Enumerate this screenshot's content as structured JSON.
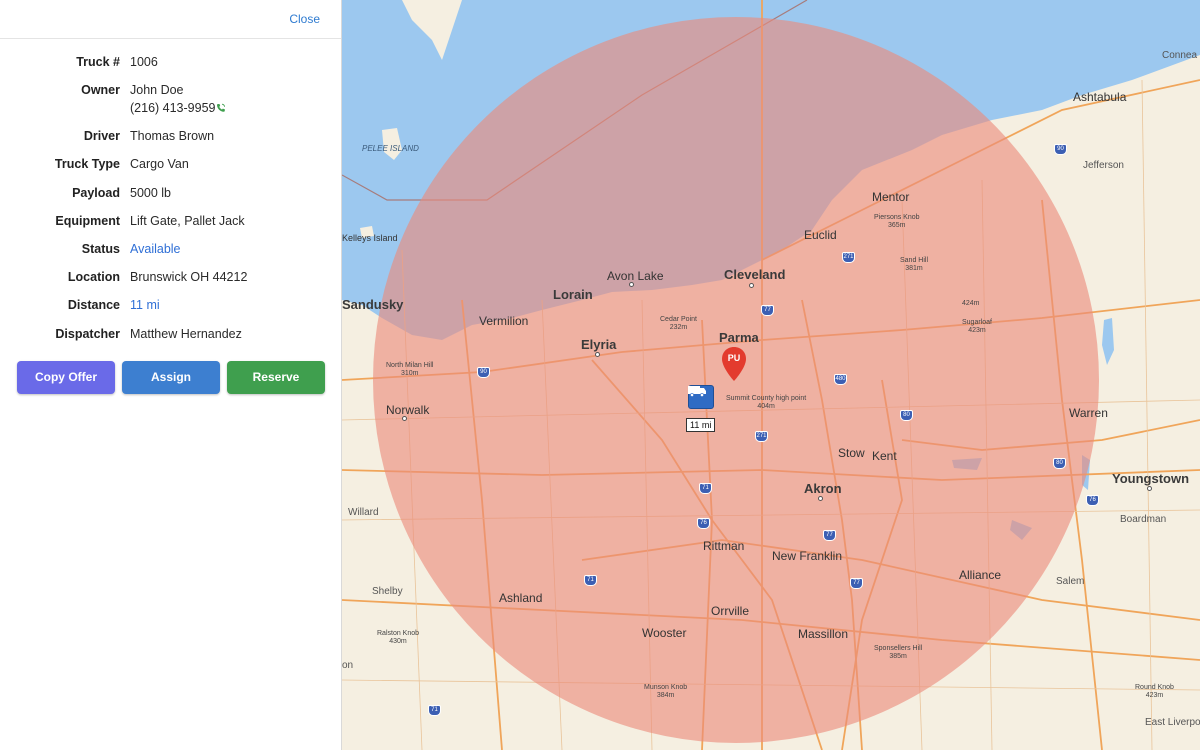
{
  "panel": {
    "close_label": "Close",
    "fields": {
      "truck_label": "Truck #",
      "truck_value": "1006",
      "owner_label": "Owner",
      "owner_name": "John Doe",
      "owner_phone": "(216) 413-9959",
      "driver_label": "Driver",
      "driver_value": "Thomas Brown",
      "type_label": "Truck Type",
      "type_value": "Cargo Van",
      "payload_label": "Payload",
      "payload_value": "5000 lb",
      "equipment_label": "Equipment",
      "equipment_value": "Lift Gate, Pallet Jack",
      "status_label": "Status",
      "status_value": "Available",
      "location_label": "Location",
      "location_value": "Brunswick OH 44212",
      "distance_label": "Distance",
      "distance_value": "11 mi",
      "dispatcher_label": "Dispatcher",
      "dispatcher_value": "Matthew Hernandez"
    },
    "buttons": {
      "copy": "Copy Offer",
      "assign": "Assign",
      "reserve": "Reserve"
    }
  },
  "map": {
    "truck_distance_tag": "11 mi",
    "pickup_marker_label": "PU",
    "labels": {
      "cleveland": "Cleveland",
      "lorain": "Lorain",
      "elyria": "Elyria",
      "parma": "Parma",
      "akron": "Akron",
      "youngstown": "Youngstown",
      "sandusky": "Sandusky",
      "avon_lake": "Avon Lake",
      "vermilion": "Vermilion",
      "norwalk": "Norwalk",
      "euclid": "Euclid",
      "mentor": "Mentor",
      "ashtabula": "Ashtabula",
      "jefferson": "Jefferson",
      "conneaut": "Connea",
      "warren": "Warren",
      "boardman": "Boardman",
      "stow": "Stow",
      "kent": "Kent",
      "alliance": "Alliance",
      "salem": "Salem",
      "massillon": "Massillon",
      "orrville": "Orrville",
      "wooster": "Wooster",
      "ashland": "Ashland",
      "rittman": "Rittman",
      "new_franklin": "New Franklin",
      "shelby": "Shelby",
      "willard": "Willard",
      "east_liverpool": "East Liverpo",
      "ion": "on",
      "kelleys_island": "Kelleys Island",
      "pelee_island": "PELEE ISLAND",
      "cedar_point": "Cedar Point\n232m",
      "summit_high": "Summit County high point\n404m",
      "pierson_knob": "Piersons Knob\n365m",
      "sand_hill": "Sand Hill\n381m",
      "sugarloaf": "Sugarloaf\n423m",
      "north_milan": "North Milan Hill\n310m",
      "ralston_knob": "Ralston Knob\n430m",
      "munson_knob": "Munson Knob\n384m",
      "sponseller_hill": "Sponsellers Hill\n385m",
      "round_knob": "Round Knob\n423m",
      "unnamed_424": "424m"
    },
    "shields": [
      "90",
      "271",
      "77",
      "480",
      "80",
      "71",
      "76",
      "77",
      "71",
      "271",
      "80",
      "90",
      "76",
      "77",
      "71"
    ]
  },
  "colors": {
    "radius_fill": "#ec8a7a",
    "lake": "#9cc8ef",
    "land": "#f5efe1",
    "truck": "#2f6bc4",
    "pickup": "#e33b2e"
  }
}
